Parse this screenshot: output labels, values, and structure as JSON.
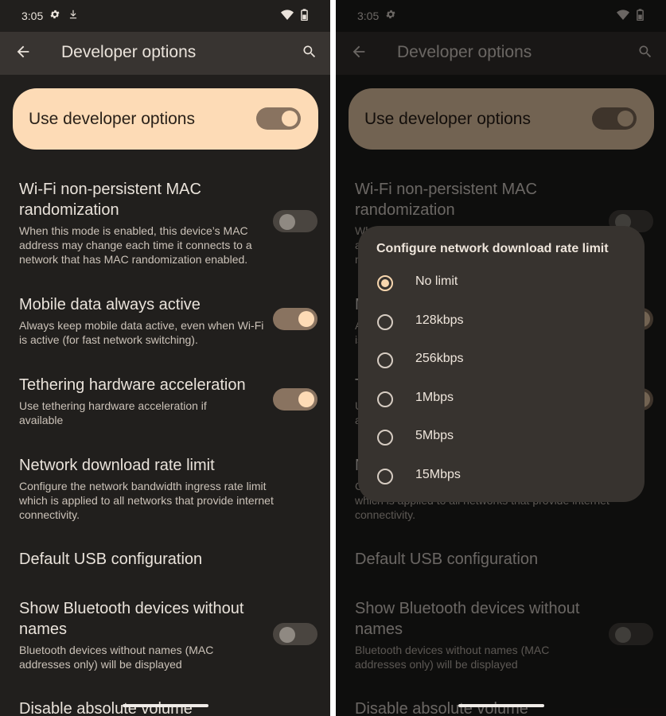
{
  "status": {
    "time": "3:05"
  },
  "appbar": {
    "title": "Developer options"
  },
  "main_toggle": {
    "label": "Use developer options",
    "on": true
  },
  "prefs": [
    {
      "title": "Wi-Fi non-persistent MAC randomization",
      "summary": "When this mode is enabled, this device’s MAC address may change each time it connects to a network that has MAC randomization enabled.",
      "switch": "off"
    },
    {
      "title": "Mobile data always active",
      "summary": "Always keep mobile data active, even when Wi-Fi is active (for fast network switching).",
      "switch": "on"
    },
    {
      "title": "Tethering hardware acceleration",
      "summary": "Use tethering hardware acceleration if available",
      "switch": "on"
    },
    {
      "title": "Network download rate limit",
      "summary": "Configure the network bandwidth ingress rate limit which is applied to all networks that provide internet connectivity.",
      "switch": "none"
    },
    {
      "title": "Default USB configuration",
      "summary": "",
      "switch": "none"
    },
    {
      "title": "Show Bluetooth devices without names",
      "summary": "Bluetooth devices without names (MAC addresses only) will be displayed",
      "switch": "off"
    },
    {
      "title": "Disable absolute volume",
      "summary": "",
      "switch": "none"
    }
  ],
  "dialog": {
    "title": "Configure network download rate limit",
    "options": [
      {
        "label": "No limit",
        "selected": true
      },
      {
        "label": "128kbps",
        "selected": false
      },
      {
        "label": "256kbps",
        "selected": false
      },
      {
        "label": "1Mbps",
        "selected": false
      },
      {
        "label": "5Mbps",
        "selected": false
      },
      {
        "label": "15Mbps",
        "selected": false
      }
    ]
  },
  "colors": {
    "background": "#211f1d",
    "appbar": "#383431",
    "accent_container": "#fddbb6",
    "switch_on_track": "#897360",
    "dialog_surface": "#37332f"
  }
}
